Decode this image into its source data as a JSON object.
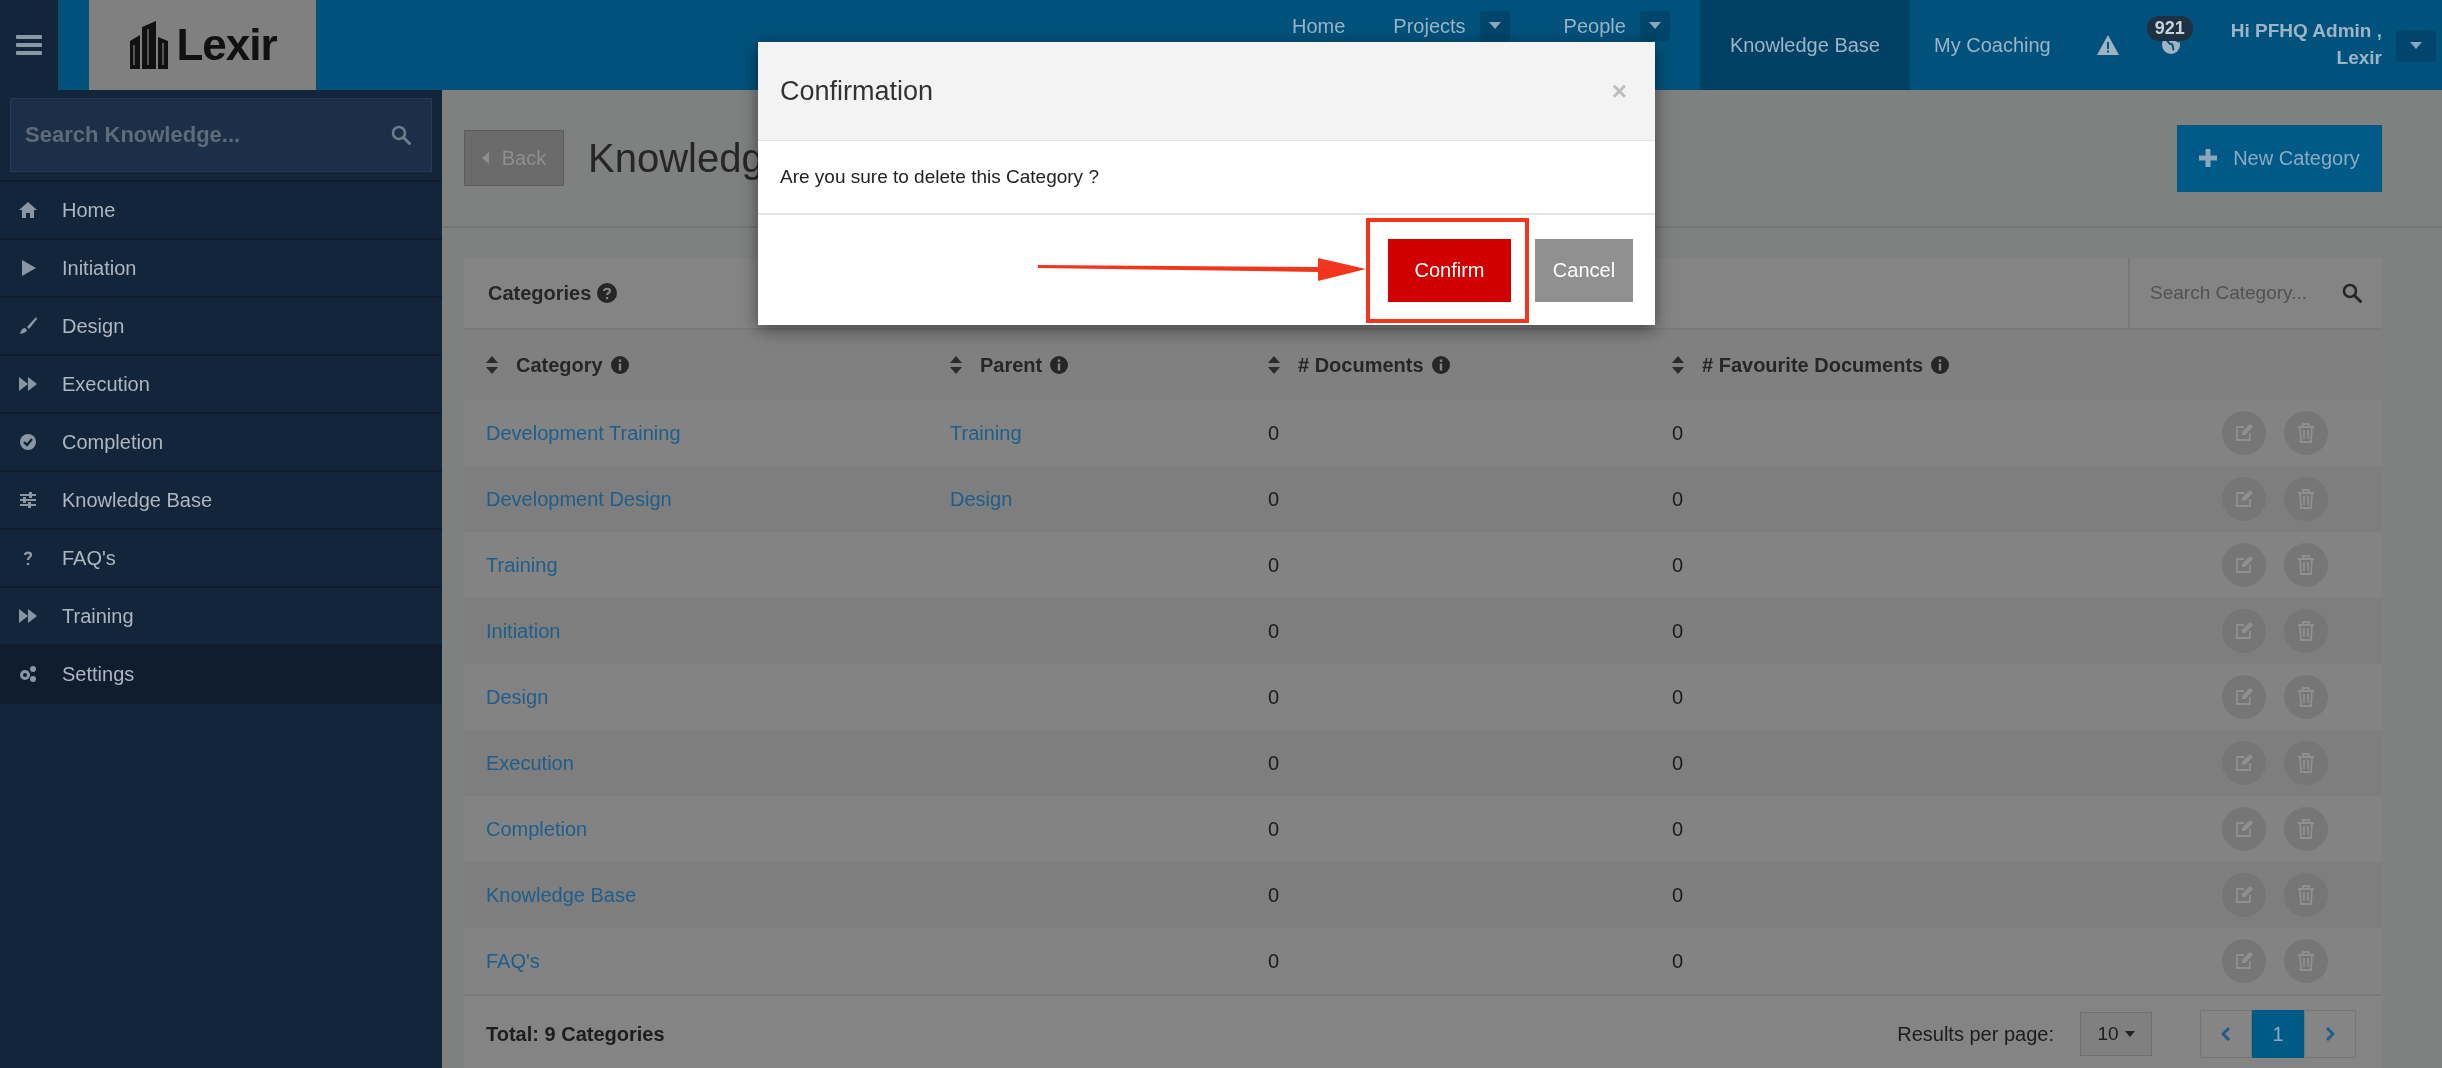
{
  "topbar": {
    "logo": "Lexir",
    "nav": [
      {
        "label": "Home",
        "selected": false,
        "dropdown": false
      },
      {
        "label": "Projects",
        "selected": false,
        "dropdown": true
      },
      {
        "label": "People",
        "selected": false,
        "dropdown": true
      },
      {
        "label": "Knowledge Base",
        "selected": true,
        "dropdown": false
      },
      {
        "label": "My Coaching",
        "selected": false,
        "dropdown": false
      }
    ],
    "badge": "921",
    "user": {
      "greeting": "Hi PFHQ Admin ,",
      "org": "Lexir"
    }
  },
  "sidebar": {
    "search": {
      "placeholder": "Search Knowledge..."
    },
    "items": [
      {
        "label": "Home",
        "selected": false
      },
      {
        "label": "Initiation",
        "selected": false
      },
      {
        "label": "Design",
        "selected": false
      },
      {
        "label": "Execution",
        "selected": false
      },
      {
        "label": "Completion",
        "selected": false
      },
      {
        "label": "Knowledge Base",
        "selected": false
      },
      {
        "label": "FAQ's",
        "selected": false
      },
      {
        "label": "Training",
        "selected": false
      },
      {
        "label": "Settings",
        "selected": true
      }
    ]
  },
  "page": {
    "back": "Back",
    "title": "Knowledg",
    "new_button": "New Category"
  },
  "panel": {
    "title": "Categories",
    "search": {
      "placeholder": "Search Category..."
    },
    "columns": [
      "Category",
      "Parent",
      "# Documents",
      "# Favourite Documents"
    ],
    "rows": [
      {
        "category": "Development Training",
        "parent": "Training",
        "documents": "0",
        "favourites": "0"
      },
      {
        "category": "Development Design",
        "parent": "Design",
        "documents": "0",
        "favourites": "0"
      },
      {
        "category": "Training",
        "documents": "0",
        "favourites": "0"
      },
      {
        "category": "Initiation",
        "documents": "0",
        "favourites": "0"
      },
      {
        "category": "Design",
        "documents": "0",
        "favourites": "0"
      },
      {
        "category": "Execution",
        "documents": "0",
        "favourites": "0"
      },
      {
        "category": "Completion",
        "documents": "0",
        "favourites": "0"
      },
      {
        "category": "Knowledge Base",
        "documents": "0",
        "favourites": "0"
      },
      {
        "category": "FAQ's",
        "documents": "0",
        "favourites": "0"
      }
    ],
    "total": "Total: 9 Categories",
    "per_page_label": "Results per page:",
    "per_page": "10",
    "pages": [
      {
        "label": "1",
        "selected": true
      }
    ]
  },
  "modal": {
    "title": "Confirmation",
    "close": "×",
    "message": "Are you sure to delete this Category ?",
    "confirm": "Confirm",
    "cancel": "Cancel"
  }
}
